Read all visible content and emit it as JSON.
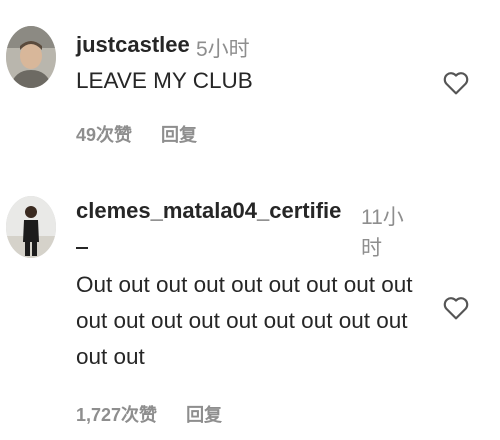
{
  "comments": [
    {
      "username": "justcastlee",
      "time": "5小时",
      "text": "LEAVE MY CLUB",
      "likes": "49次赞",
      "reply_label": "回复",
      "avatar_icon": "user-avatar-photo",
      "like_icon": "heart-outline-icon"
    },
    {
      "username": "clemes_matala04_certifie",
      "time_line1": "11小",
      "time_line2": "时",
      "text": "Out out out out out out out out out out out out out out out out out out out out",
      "likes": "1,727次赞",
      "reply_label": "回复",
      "avatar_icon": "user-avatar-photo",
      "like_icon": "heart-outline-icon"
    }
  ],
  "colors": {
    "text_primary": "#262626",
    "text_secondary": "#8e8e8e",
    "background": "#ffffff"
  }
}
